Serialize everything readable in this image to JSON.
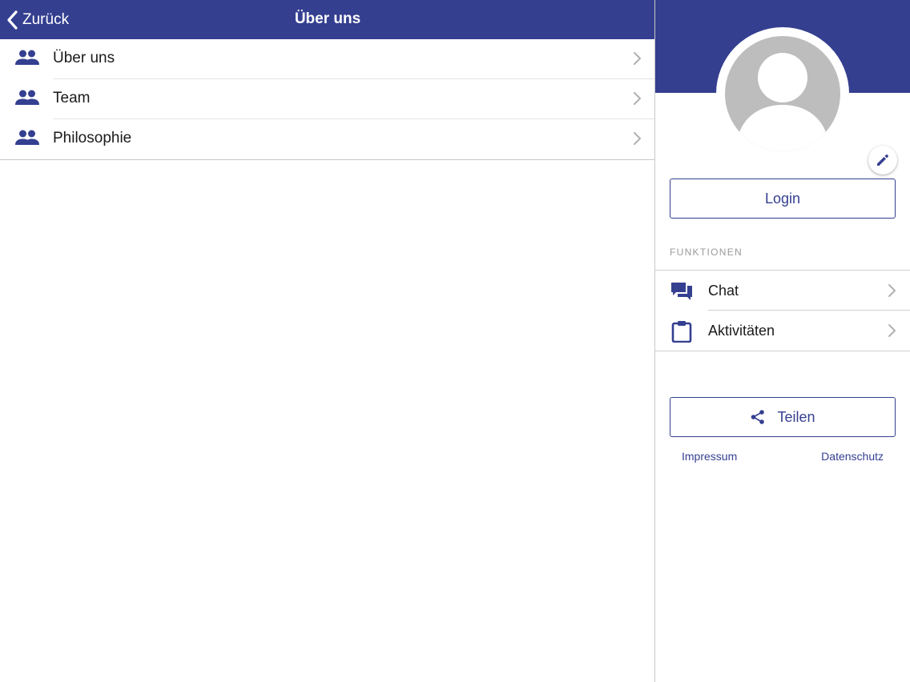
{
  "navbar": {
    "back_label": "Zurück",
    "title": "Über uns"
  },
  "menu": {
    "items": [
      {
        "label": "Über uns",
        "icon": "people-icon"
      },
      {
        "label": "Team",
        "icon": "people-icon"
      },
      {
        "label": "Philosophie",
        "icon": "people-icon"
      }
    ]
  },
  "profile": {
    "login_label": "Login",
    "section_title": "FUNKTIONEN",
    "functions": [
      {
        "label": "Chat",
        "icon": "chat-icon"
      },
      {
        "label": "Aktivitäten",
        "icon": "clipboard-icon"
      }
    ],
    "share_label": "Teilen",
    "impressum_label": "Impressum",
    "datenschutz_label": "Datenschutz"
  },
  "colors": {
    "brand": "#343f90",
    "avatar": "#bdbdbd",
    "chevron": "#b0b0b0"
  }
}
